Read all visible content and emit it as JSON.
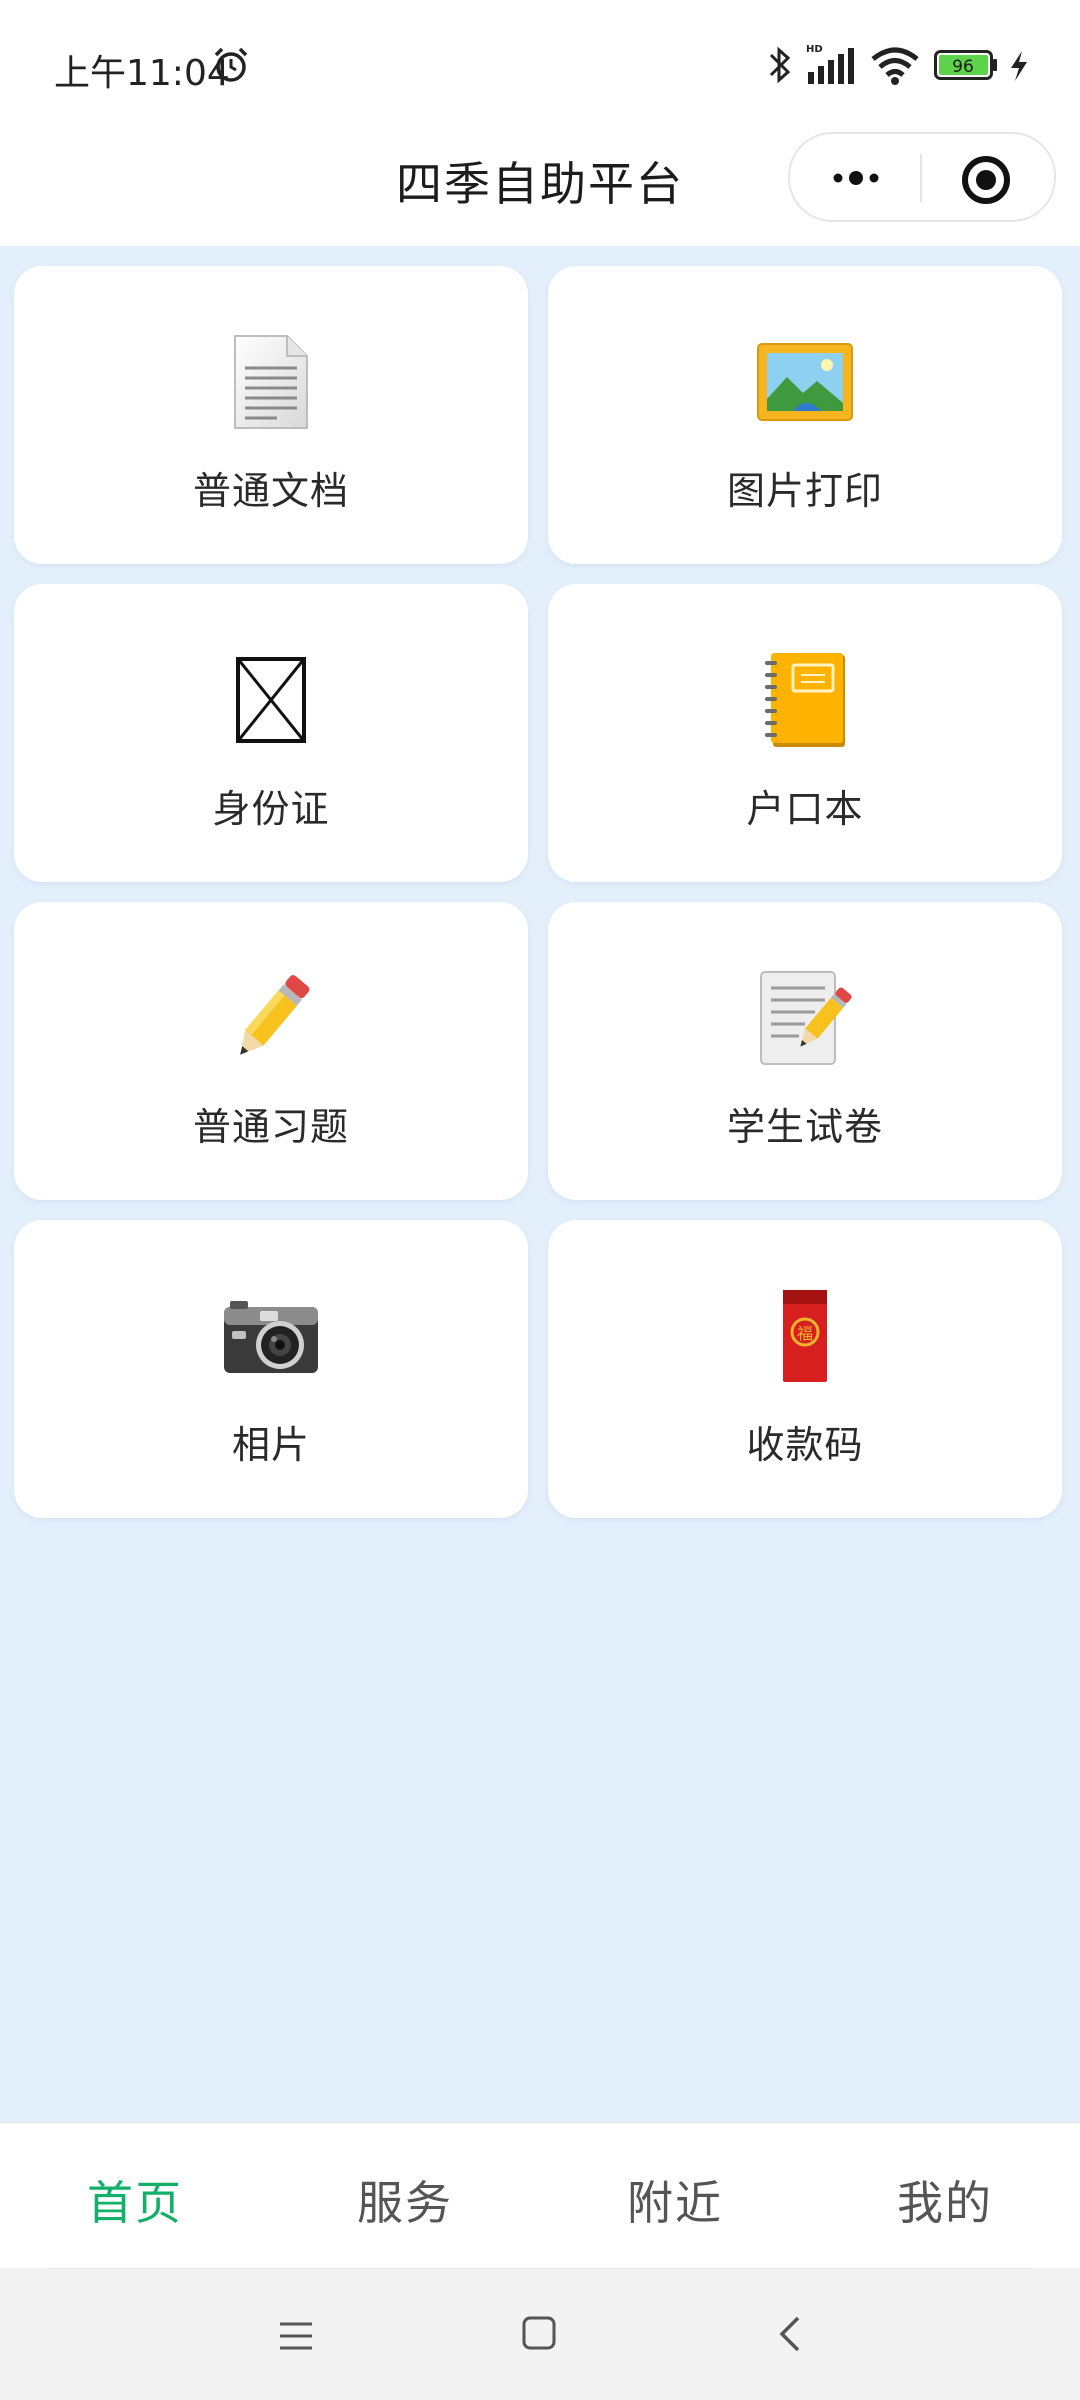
{
  "status_bar": {
    "time": "上午11:04",
    "battery_level": "96",
    "icons": [
      "alarm-icon",
      "bluetooth-icon",
      "signal-icon",
      "wifi-icon",
      "battery-icon",
      "charging-icon"
    ]
  },
  "header": {
    "title": "四季自助平台",
    "capsule_icons": [
      "more-icon",
      "target-icon"
    ]
  },
  "grid": {
    "items": [
      {
        "label": "普通文档",
        "icon": "document-icon"
      },
      {
        "label": "图片打印",
        "icon": "picture-icon"
      },
      {
        "label": "身份证",
        "icon": "id-card-placeholder-icon"
      },
      {
        "label": "户口本",
        "icon": "notebook-icon"
      },
      {
        "label": "普通习题",
        "icon": "pencil-icon"
      },
      {
        "label": "学生试卷",
        "icon": "paper-pencil-icon"
      },
      {
        "label": "相片",
        "icon": "camera-icon"
      },
      {
        "label": "收款码",
        "icon": "red-envelope-icon"
      }
    ]
  },
  "tabbar": {
    "tabs": [
      {
        "label": "首页",
        "active": true
      },
      {
        "label": "服务",
        "active": false
      },
      {
        "label": "附近",
        "active": false
      },
      {
        "label": "我的",
        "active": false
      }
    ]
  },
  "colors": {
    "background": "#e3effb",
    "card": "#ffffff",
    "active_tab": "#14b06a",
    "inactive_tab": "#555555"
  },
  "system_nav": {
    "icons": [
      "menu-icon",
      "home-icon",
      "back-icon"
    ]
  }
}
